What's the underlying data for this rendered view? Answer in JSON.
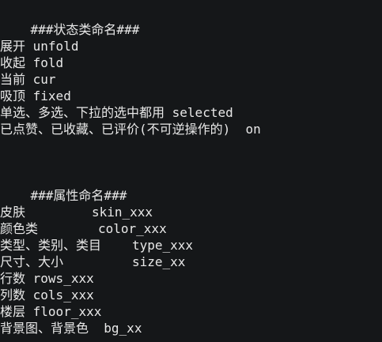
{
  "section1": {
    "heading": "###状态类命名###",
    "items": [
      {
        "label": "展开",
        "value": "unfold"
      },
      {
        "label": "收起",
        "value": "fold"
      },
      {
        "label": "当前",
        "value": "cur"
      },
      {
        "label": "吸顶",
        "value": "fixed"
      },
      {
        "label": "单选、多选、下拉的选中都用",
        "value": "selected"
      },
      {
        "label": "已点赞、已收藏、已评价(不可逆操作的)",
        "value": "on"
      }
    ]
  },
  "section2": {
    "heading": "###属性命名###",
    "items": [
      {
        "label": "皮肤",
        "value": "skin_xxx"
      },
      {
        "label": "颜色类",
        "value": "color_xxx"
      },
      {
        "label": "类型、类别、类目",
        "value": "type_xxx"
      },
      {
        "label": "尺寸、大小",
        "value": "size_xx"
      },
      {
        "label": "行数",
        "value": "rows_xxx"
      },
      {
        "label": "列数",
        "value": "cols_xxx"
      },
      {
        "label": "楼层",
        "value": "floor_xxx"
      },
      {
        "label": "背景图、背景色",
        "value": "bg_xx"
      }
    ]
  }
}
